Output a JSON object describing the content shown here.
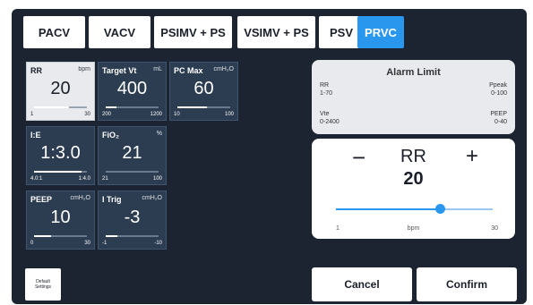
{
  "tabs": [
    "PACV",
    "VACV",
    "PSIMV + PS",
    "VSIMV + PS",
    "PSV",
    "PRVC"
  ],
  "active_tab": "PRVC",
  "params": {
    "rr": {
      "label": "RR",
      "unit": "bpm",
      "value": "20",
      "min": "1",
      "max": "30",
      "level": 0.66
    },
    "target_vt": {
      "label": "Target Vt",
      "unit": "mL",
      "value": "400",
      "min": "200",
      "max": "1200",
      "level": 0.2
    },
    "pc_max": {
      "label": "PC Max",
      "unit": "cmH₂O",
      "value": "60",
      "min": "10",
      "max": "100",
      "level": 0.56
    },
    "ie": {
      "label": "I:E",
      "unit": "",
      "value": "1:3.0",
      "min": "4.0:1",
      "max": "1:4.0",
      "level": 0.9
    },
    "fio2": {
      "label": "FiO₂",
      "unit": "%",
      "value": "21",
      "min": "21",
      "max": "100",
      "level": 0.0
    },
    "peep": {
      "label": "PEEP",
      "unit": "cmH₂O",
      "value": "10",
      "min": "0",
      "max": "30",
      "level": 0.33
    },
    "itrig": {
      "label": "I Trig",
      "unit": "cmH₂O",
      "value": "-3",
      "min": "-1",
      "max": "-10",
      "level": 0.22
    }
  },
  "alarm": {
    "title": "Alarm Limit",
    "rr_label": "RR",
    "rr_range": "1-70",
    "ppeak_label": "Ppeak",
    "ppeak_range": "0-100",
    "vte_label": "Vte",
    "vte_range": "0-2400",
    "peep_label": "PEEP",
    "peep_range": "0-40"
  },
  "adjust": {
    "minus": "−",
    "plus": "+",
    "name": "RR",
    "value": "20",
    "min": "1",
    "unit": "bpm",
    "max": "30",
    "level": 0.66
  },
  "buttons": {
    "default_line1": "Default",
    "default_line2": "Settings",
    "cancel": "Cancel",
    "confirm": "Confirm"
  },
  "colors": {
    "accent": "#2a97ef",
    "screen": "#1c2431",
    "tile": "#2c3d52"
  }
}
